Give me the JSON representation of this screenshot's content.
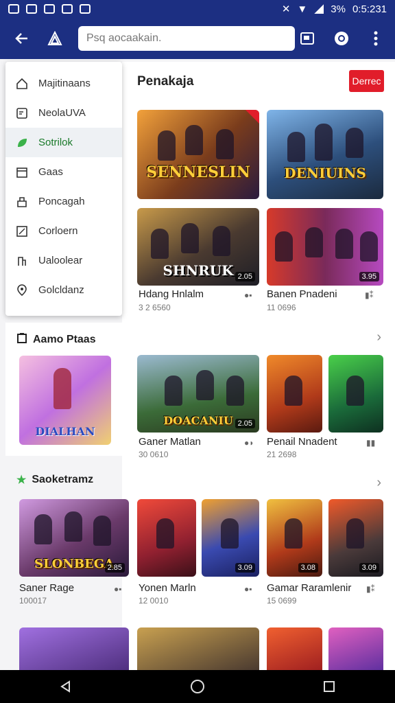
{
  "status": {
    "battery": "3%",
    "time": "0:5:231"
  },
  "search": {
    "placeholder": "Psq aocaakain."
  },
  "drawer": {
    "items": [
      {
        "label": "Majitinaans",
        "icon": "home-icon"
      },
      {
        "label": "NeolaUVA",
        "icon": "tablet-icon"
      },
      {
        "label": "Sotrilok",
        "icon": "leaf-icon"
      },
      {
        "label": "Gaas",
        "icon": "store-icon"
      },
      {
        "label": "Poncagah",
        "icon": "bag-icon"
      },
      {
        "label": "Corloern",
        "icon": "percent-icon"
      },
      {
        "label": "Ualoolear",
        "icon": "door-icon"
      },
      {
        "label": "Golcldanz",
        "icon": "location-icon"
      }
    ],
    "active_index": 2
  },
  "side_sections": [
    {
      "title": "Aamo Ptaas",
      "icon": "clipboard-icon",
      "tile_logo": "DIALHAN"
    },
    {
      "title": "Saoketramz",
      "icon": "star-icon"
    }
  ],
  "main": {
    "section_title": "Penakaja",
    "section_button": "Derrec",
    "rows": [
      {
        "games": [
          {
            "logo": "SENNESLIN",
            "badge": ""
          },
          {
            "logo": "DENIUINS",
            "badge": ""
          }
        ]
      },
      {
        "games": [
          {
            "logo": "SHNRUK",
            "badge": "2.05",
            "title": "Hdang Hnlalm",
            "meta": "3 2 6560"
          },
          {
            "logo": "",
            "badge": "3.95",
            "title": "Banen Pnadeni",
            "meta": "11 0696"
          }
        ]
      },
      {
        "games": [
          {
            "logo": "DOACANIU",
            "badge": "2.05",
            "title": "Ganer Matlan",
            "meta": "30 0610"
          },
          {
            "logo": "",
            "badge": "",
            "title": "Penail Nnadent",
            "meta": "21 2698"
          }
        ]
      },
      {
        "games": [
          {
            "logo": "SLONBEGA",
            "badge": "2.85",
            "title": "Saner Rage",
            "meta": "100017"
          },
          {
            "logo": "",
            "badge": "3.09",
            "title": "Yonen Marln",
            "meta": "12 0010"
          },
          {
            "logo": "",
            "badge": "3.08",
            "title": "Gamar Raramlenir",
            "meta": "15 0699"
          },
          {
            "logo": "",
            "badge": "3.09",
            "title": "",
            "meta": ""
          }
        ]
      }
    ]
  },
  "colors": {
    "app_bar": "#1c2f82",
    "accent_red": "#e11d2a",
    "active_item": "#3bb24a"
  }
}
